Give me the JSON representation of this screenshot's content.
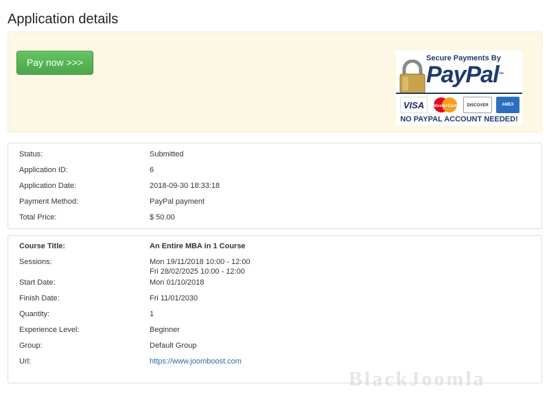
{
  "page": {
    "title": "Application details"
  },
  "payment": {
    "pay_button_label": "Pay now >>>",
    "badge": {
      "secure_text": "Secure Payments By",
      "logo_text": "PayPal",
      "trademark": "™",
      "cards": [
        "VISA",
        "MasterCard",
        "DISCOVER",
        "AMEX"
      ],
      "no_account_text": "NO PAYPAL ACCOUNT NEEDED!"
    }
  },
  "application": {
    "rows": [
      {
        "label": "Status:",
        "value": "Submitted"
      },
      {
        "label": "Application ID:",
        "value": "6"
      },
      {
        "label": "Application Date:",
        "value": "2018-09-30 18:33:18"
      },
      {
        "label": "Payment Method:",
        "value": "PayPal payment"
      },
      {
        "label": "Total Price:",
        "value": "$ 50.00"
      }
    ]
  },
  "course": {
    "title_label": "Course Title:",
    "title_value": "An Entire MBA in 1 Course",
    "sessions_label": "Sessions:",
    "sessions": [
      "Mon 19/11/2018 10:00 - 12:00",
      "Fri 28/02/2025 10:00 - 12:00"
    ],
    "rows": [
      {
        "label": "Start Date:",
        "value": "Mon 01/10/2018"
      },
      {
        "label": "Finish Date:",
        "value": "Fri 11/01/2030"
      },
      {
        "label": "Quantity:",
        "value": "1"
      },
      {
        "label": "Experience Level:",
        "value": "Beginner"
      },
      {
        "label": "Group:",
        "value": "Default Group"
      }
    ],
    "url_label": "Url:",
    "url_value": "https://www.joomboost.com"
  },
  "watermark": {
    "text": "BlackJoomla"
  },
  "colors": {
    "pay_button": "#5cb85c",
    "panel_bg": "#fcf8e3",
    "paypal_navy": "#1d3a70",
    "link": "#2a6aa8"
  }
}
